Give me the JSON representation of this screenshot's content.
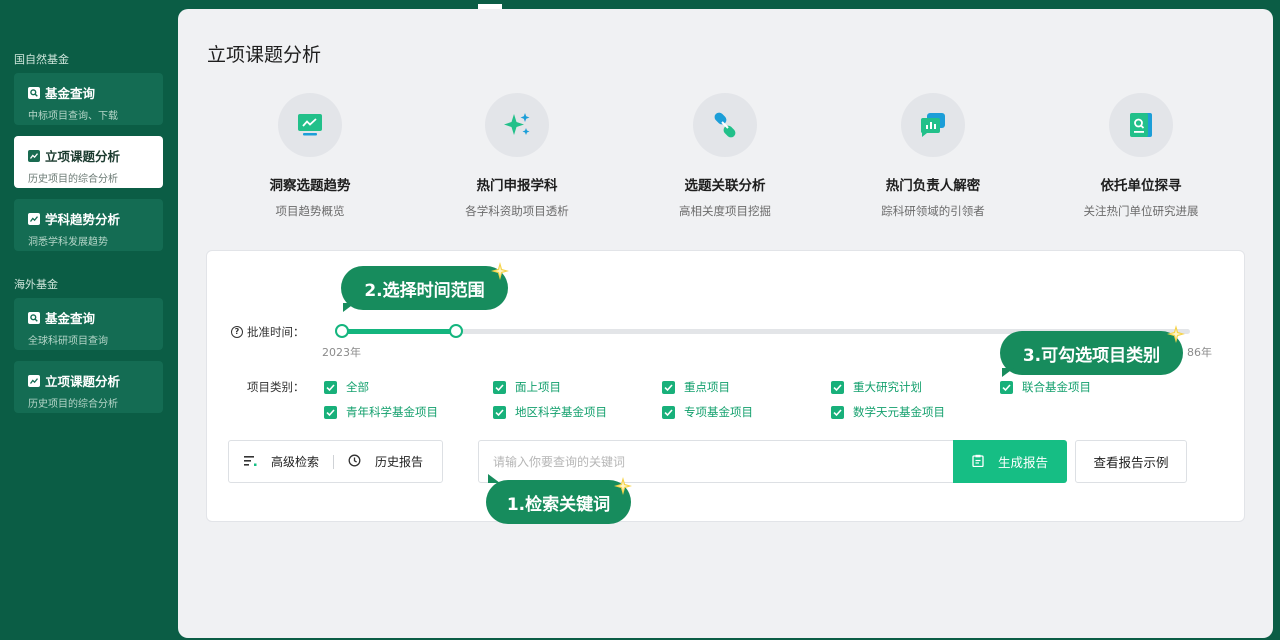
{
  "sidebar": {
    "group1_title": "国自然基金",
    "group2_title": "海外基金",
    "items": [
      {
        "label": "基金查询",
        "sub": "中标项目查询、下载"
      },
      {
        "label": "立项课题分析",
        "sub": "历史项目的综合分析"
      },
      {
        "label": "学科趋势分析",
        "sub": "洞悉学科发展趋势"
      },
      {
        "label": "基金查询",
        "sub": "全球科研项目查询"
      },
      {
        "label": "立项课题分析",
        "sub": "历史项目的综合分析"
      }
    ]
  },
  "main": {
    "title": "立项课题分析",
    "features": [
      {
        "title": "洞察选题趋势",
        "sub": "项目趋势概览",
        "icon": "trend-monitor-icon"
      },
      {
        "title": "热门申报学科",
        "sub": "各学科资助项目透析",
        "icon": "sparkle-icon"
      },
      {
        "title": "选题关联分析",
        "sub": "高相关度项目挖掘",
        "icon": "link-icon"
      },
      {
        "title": "热门负责人解密",
        "sub": "踪科研领域的引领者",
        "icon": "chat-chart-icon"
      },
      {
        "title": "依托单位探寻",
        "sub": "关注热门单位研究进展",
        "icon": "book-search-icon"
      }
    ]
  },
  "filter": {
    "time_label": "批准时间：",
    "year_start": "2023年",
    "year_end": "86年",
    "category_label": "项目类别：",
    "categories": [
      "全部",
      "面上项目",
      "重点项目",
      "重大研究计划",
      "联合基金项目",
      "青年科学基金项目",
      "地区科学基金项目",
      "专项基金项目",
      "数学天元基金项目"
    ]
  },
  "actions": {
    "advanced_search": "高级检索",
    "history_report": "历史报告",
    "search_placeholder": "请输入你要查询的关键词",
    "generate_report": "生成报告",
    "view_example": "查看报告示例"
  },
  "callouts": {
    "time": "2.选择时间范围",
    "category": "3.可勾选项目类别",
    "keyword": "1.检索关键词"
  },
  "colors": {
    "brand_dark": "#0b5d45",
    "accent": "#16be84",
    "callout": "#178c5d"
  }
}
